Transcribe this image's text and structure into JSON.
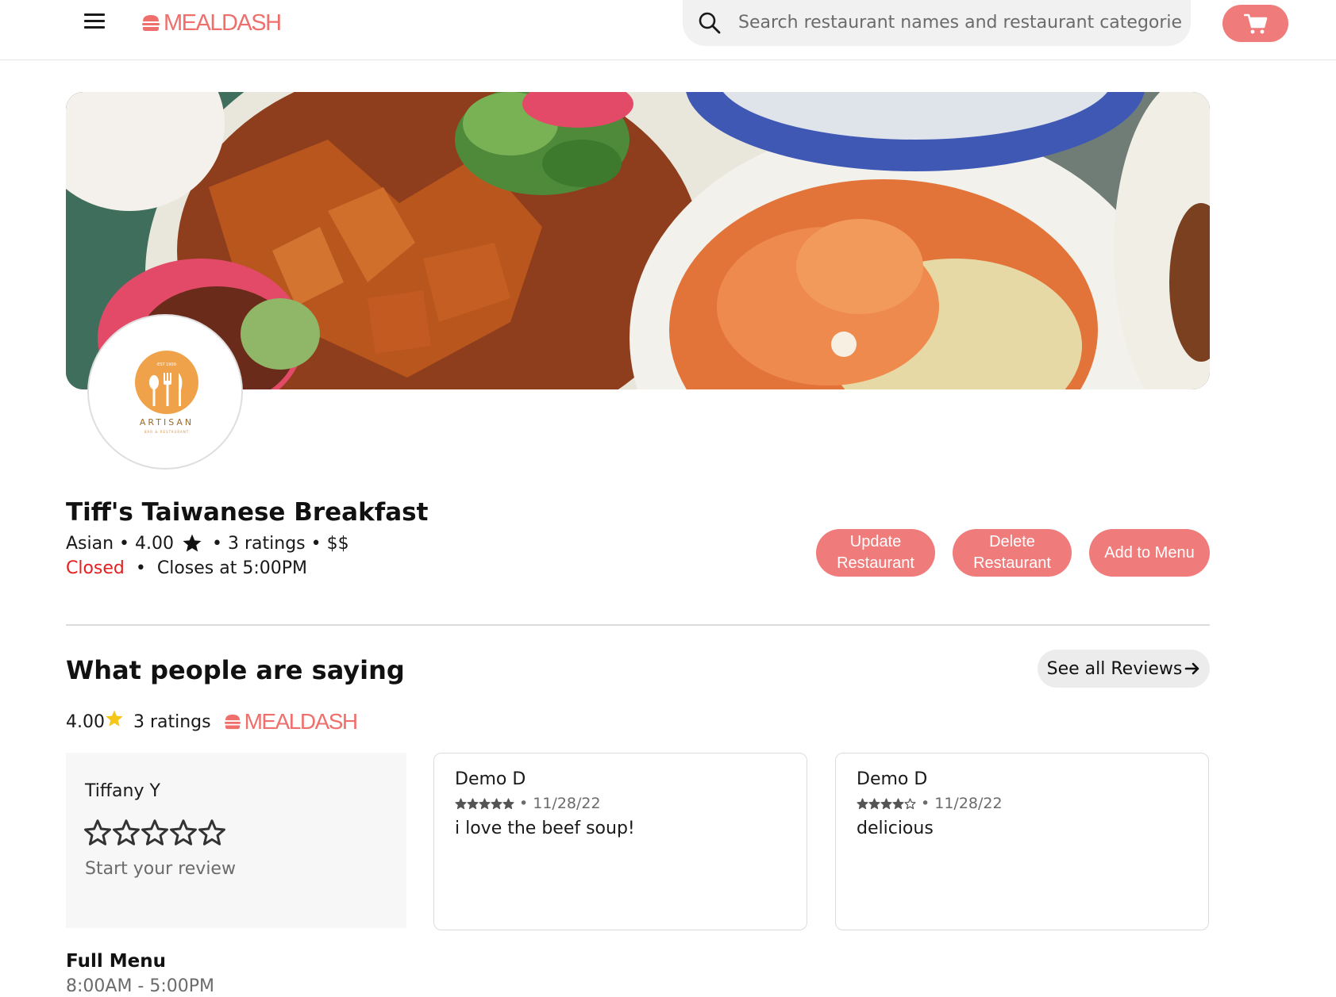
{
  "header": {
    "brand": "MEALDASH",
    "search_placeholder": "Search restaurant names and restaurant categories",
    "menu_icon": "hamburger-icon",
    "cart_icon": "cart-icon"
  },
  "colors": {
    "brand": "#ef6f6c",
    "button": "#ef7b7a",
    "closed": "#e61e1e",
    "star_yellow": "#f5c518"
  },
  "restaurant": {
    "name": "Tiff's Taiwanese Breakfast",
    "category": "Asian",
    "rating": "4.00",
    "ratings_count": "3 ratings",
    "price": "$$",
    "status": "Closed",
    "closes": "Closes at 5:00PM",
    "logo": {
      "top_text": "·EST 1900·",
      "name": "ARTISAN",
      "sub": "BAR & RESTAURANT"
    }
  },
  "actions": {
    "update_line1": "Update",
    "update_line2": "Restaurant",
    "delete_line1": "Delete",
    "delete_line2": "Restaurant",
    "add_menu": "Add to Menu"
  },
  "reviews_section": {
    "title": "What people are saying",
    "see_all": "See all Reviews",
    "rating": "4.00",
    "ratings_count": "3 ratings",
    "brand": "MEALDASH"
  },
  "my_review": {
    "user": "Tiffany Y",
    "prompt": "Start your review",
    "rating": 0,
    "max": 5
  },
  "reviews": [
    {
      "user": "Demo D",
      "stars": 5,
      "date": "11/28/22",
      "text": "i love the beef soup!"
    },
    {
      "user": "Demo D",
      "stars": 4,
      "date": "11/28/22",
      "text": "delicious"
    }
  ],
  "menu": {
    "title": "Full Menu",
    "hours": "8:00AM - 5:00PM"
  }
}
